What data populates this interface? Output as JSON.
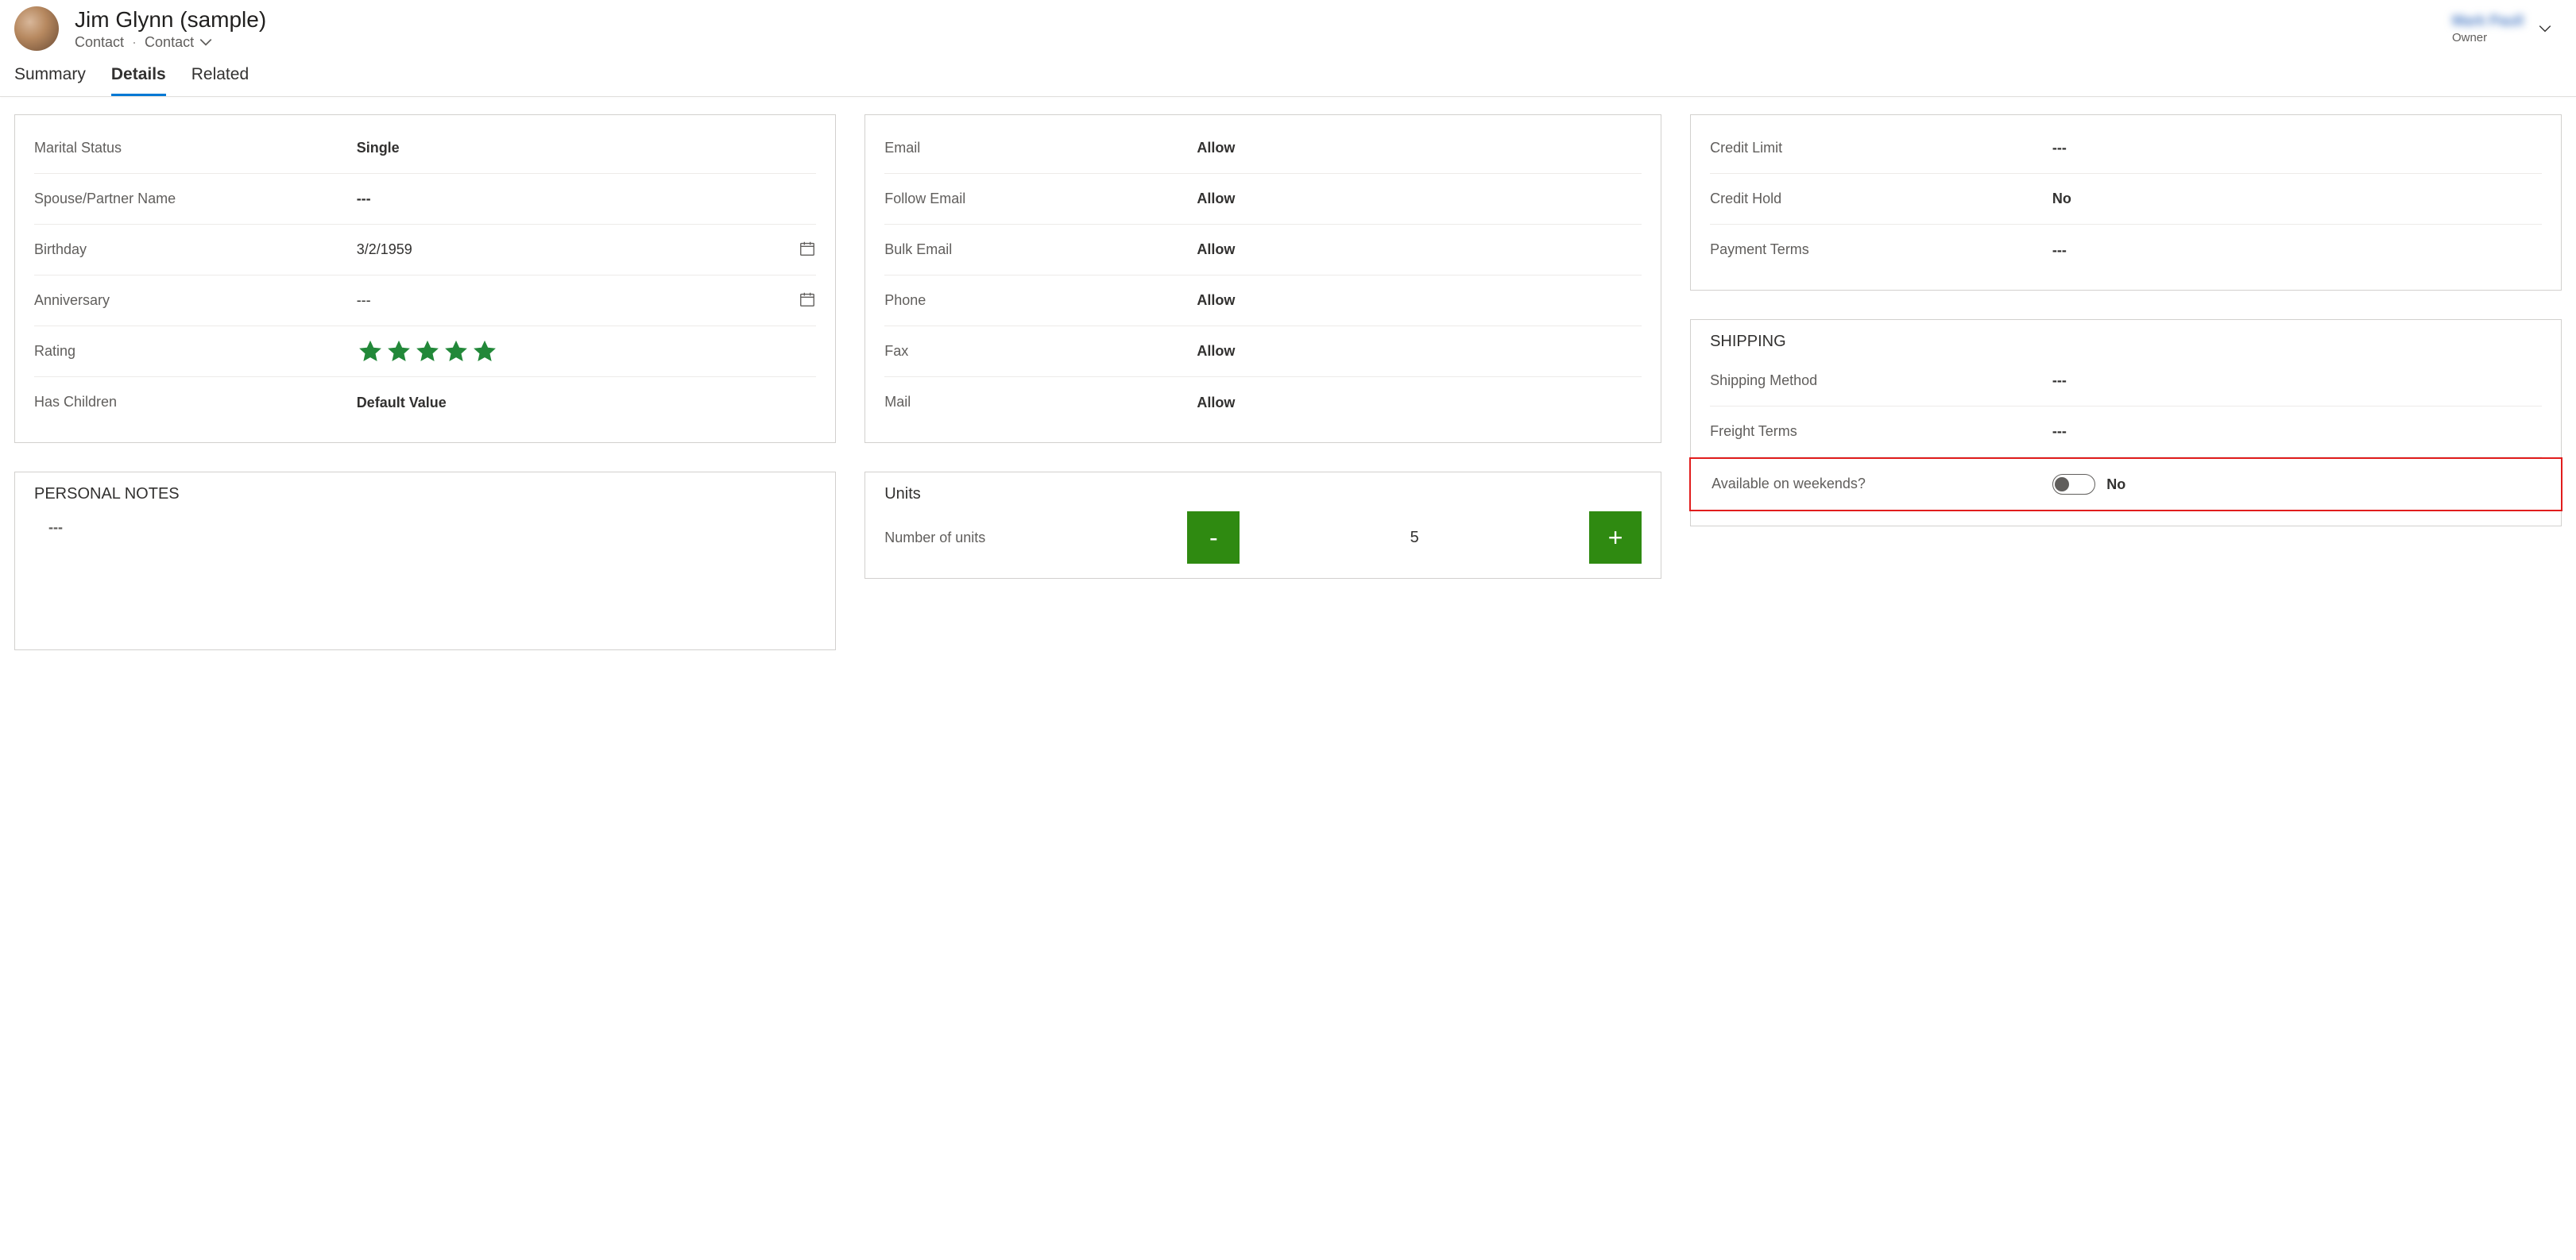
{
  "header": {
    "title": "Jim Glynn (sample)",
    "entity": "Contact",
    "entity_selector": "Contact",
    "owner_name": "Mark Paull",
    "owner_label": "Owner"
  },
  "tabs": [
    {
      "label": "Summary",
      "active": false
    },
    {
      "label": "Details",
      "active": true
    },
    {
      "label": "Related",
      "active": false
    }
  ],
  "personal": {
    "marital_status_label": "Marital Status",
    "marital_status_value": "Single",
    "spouse_label": "Spouse/Partner Name",
    "spouse_value": "---",
    "birthday_label": "Birthday",
    "birthday_value": "3/2/1959",
    "anniversary_label": "Anniversary",
    "anniversary_value": "---",
    "rating_label": "Rating",
    "rating_value": 5,
    "children_label": "Has Children",
    "children_value": "Default Value"
  },
  "notes": {
    "title": "PERSONAL NOTES",
    "body": "---"
  },
  "contact_prefs": {
    "email_label": "Email",
    "email_value": "Allow",
    "follow_label": "Follow Email",
    "follow_value": "Allow",
    "bulk_label": "Bulk Email",
    "bulk_value": "Allow",
    "phone_label": "Phone",
    "phone_value": "Allow",
    "fax_label": "Fax",
    "fax_value": "Allow",
    "mail_label": "Mail",
    "mail_value": "Allow"
  },
  "units": {
    "title": "Units",
    "label": "Number of units",
    "value": "5",
    "minus": "-",
    "plus": "+"
  },
  "billing": {
    "credit_limit_label": "Credit Limit",
    "credit_limit_value": "---",
    "credit_hold_label": "Credit Hold",
    "credit_hold_value": "No",
    "payment_terms_label": "Payment Terms",
    "payment_terms_value": "---"
  },
  "shipping": {
    "title": "SHIPPING",
    "method_label": "Shipping Method",
    "method_value": "---",
    "freight_label": "Freight Terms",
    "freight_value": "---",
    "weekends_label": "Available on weekends?",
    "weekends_value": "No"
  }
}
